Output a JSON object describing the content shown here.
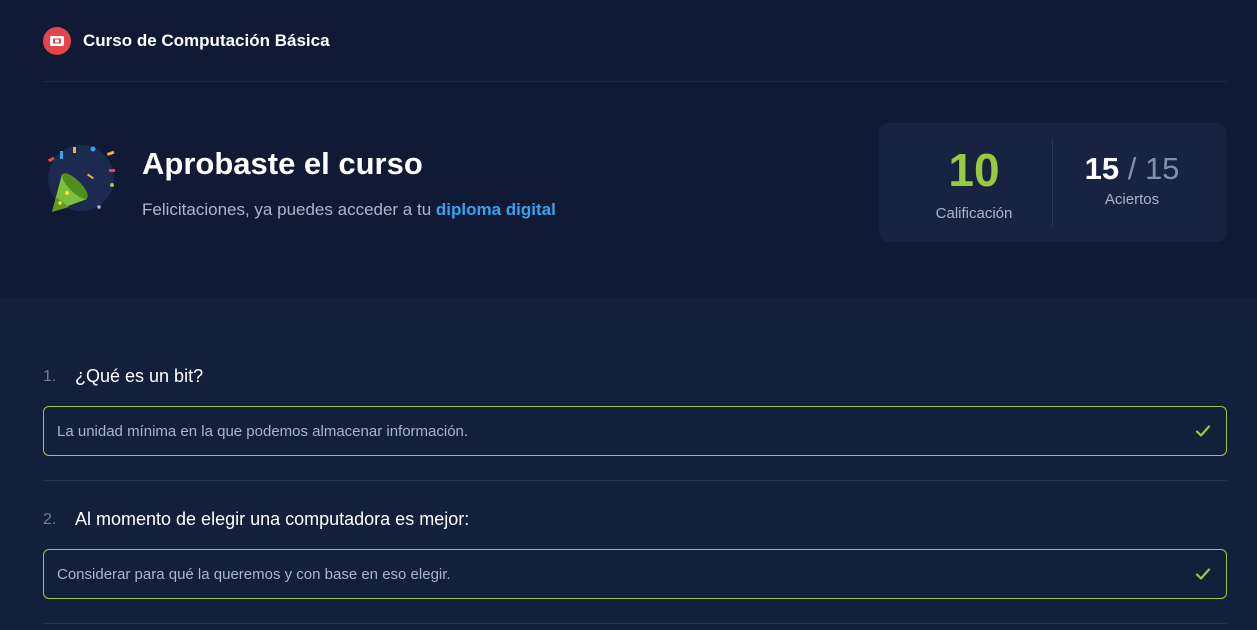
{
  "header": {
    "course_title": "Curso de Computación Básica",
    "logo_icon": "video-icon"
  },
  "result": {
    "title": "Aprobaste el curso",
    "subtitle": "Felicitaciones, ya puedes acceder a tu",
    "diploma_link": "diploma digital",
    "icon": "party-popper-icon"
  },
  "score": {
    "grade": "10",
    "grade_label": "Calificación",
    "correct": "15",
    "separator": "/",
    "total": "15",
    "correct_label": "Aciertos"
  },
  "questions": [
    {
      "number": "1.",
      "text": "¿Qué es un bit?",
      "answer": "La unidad mínima en la que podemos almacenar información.",
      "status": "correct"
    },
    {
      "number": "2.",
      "text": "Al momento de elegir una computadora es mejor:",
      "answer": "Considerar para qué la queremos y con base en eso elegir.",
      "status": "correct"
    }
  ],
  "colors": {
    "accent_green": "#98ca3f",
    "link_blue": "#3aa0f0",
    "logo_red": "#e5454a",
    "header_bg": "#101a35",
    "body_bg": "#13203b"
  }
}
